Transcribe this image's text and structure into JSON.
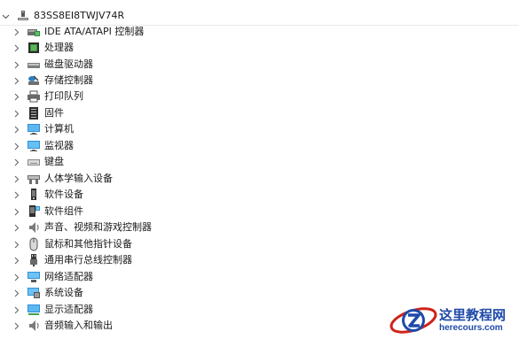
{
  "computer": {
    "name": "83SS8EI8TWJV74R",
    "expanded": true
  },
  "categories": [
    {
      "label": "IDE ATA/ATAPI 控制器",
      "icon": "ide-controller-icon"
    },
    {
      "label": "处理器",
      "icon": "processor-icon"
    },
    {
      "label": "磁盘驱动器",
      "icon": "disk-drive-icon"
    },
    {
      "label": "存储控制器",
      "icon": "storage-controller-icon"
    },
    {
      "label": "打印队列",
      "icon": "printer-icon"
    },
    {
      "label": "固件",
      "icon": "firmware-icon"
    },
    {
      "label": "计算机",
      "icon": "computer-icon"
    },
    {
      "label": "监视器",
      "icon": "monitor-icon"
    },
    {
      "label": "键盘",
      "icon": "keyboard-icon"
    },
    {
      "label": "人体学输入设备",
      "icon": "hid-icon"
    },
    {
      "label": "软件设备",
      "icon": "software-device-icon"
    },
    {
      "label": "软件组件",
      "icon": "software-component-icon"
    },
    {
      "label": "声音、视频和游戏控制器",
      "icon": "speaker-icon"
    },
    {
      "label": "鼠标和其他指针设备",
      "icon": "mouse-icon"
    },
    {
      "label": "通用串行总线控制器",
      "icon": "usb-icon"
    },
    {
      "label": "网络适配器",
      "icon": "network-adapter-icon"
    },
    {
      "label": "系统设备",
      "icon": "system-device-icon"
    },
    {
      "label": "显示适配器",
      "icon": "display-adapter-icon"
    },
    {
      "label": "音频输入和输出",
      "icon": "audio-io-icon"
    }
  ],
  "watermark": {
    "name": "这里教程网",
    "url": "herecours.com"
  },
  "colors": {
    "caret": "#6b6b6b",
    "watermark_blue": "#1f4aa8",
    "watermark_red": "#d0231b"
  }
}
